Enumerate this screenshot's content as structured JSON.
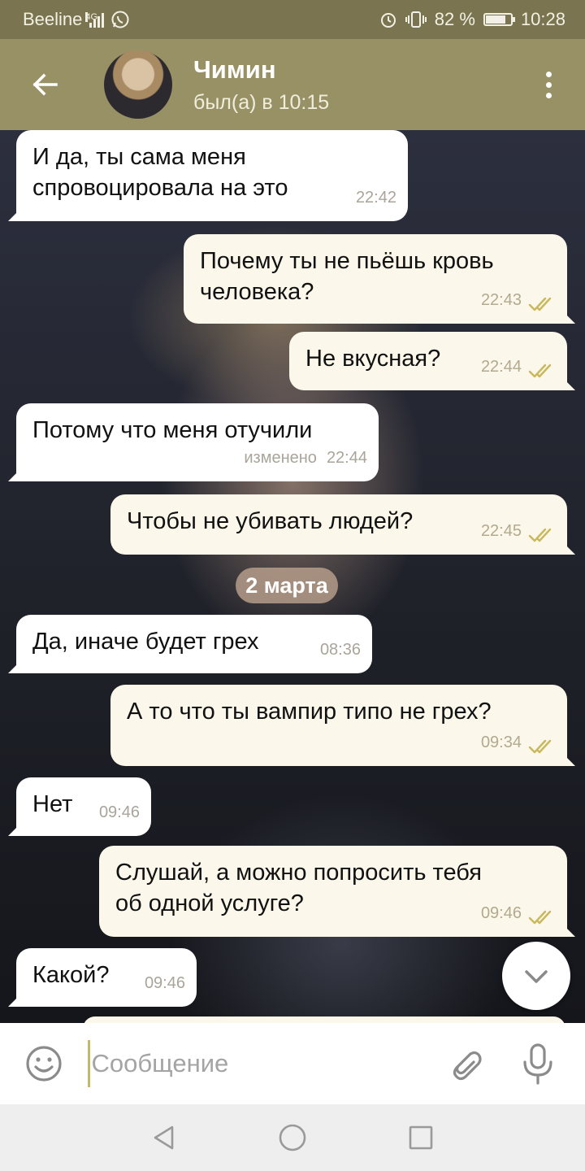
{
  "status_bar": {
    "carrier": "Beeline",
    "network": "4G",
    "battery_text": "82 %",
    "battery_level": 0.82,
    "time": "10:28"
  },
  "header": {
    "name": "Чимин",
    "last_seen": "был(а) в 10:15"
  },
  "messages": [
    {
      "direction": "in",
      "text": "И да, ты сама меня\nспровоцировала на это",
      "time": "22:42"
    },
    {
      "direction": "out",
      "text": "Почему ты не пьёшь кровь\nчеловека?",
      "time": "22:43"
    },
    {
      "direction": "out",
      "text": "Не вкусная?",
      "time": "22:44"
    },
    {
      "direction": "in",
      "text": "Потому что меня отучили",
      "edited": "изменено",
      "time": "22:44"
    },
    {
      "direction": "out",
      "text": "Чтобы не убивать людей?",
      "time": "22:45"
    },
    {
      "direction": "in",
      "text": "Да, иначе будет грех",
      "time": "08:36"
    },
    {
      "direction": "out",
      "text": "А то что ты вампир типо не грех?",
      "time": "09:34"
    },
    {
      "direction": "in",
      "text": "Нет",
      "time": "09:46"
    },
    {
      "direction": "out",
      "text": "Слушай, а можно попросить тебя\nоб одной услуге?",
      "time": "09:46"
    },
    {
      "direction": "in",
      "text": "Какой?",
      "time": "09:46"
    }
  ],
  "date_separator": "2 марта",
  "input": {
    "placeholder": "Сообщение"
  },
  "colors": {
    "status_bar": "#7a7550",
    "header": "#999166",
    "outgoing_bubble": "#fbf7ea",
    "incoming_bubble": "#ffffff",
    "read_checks": "#c9b85c",
    "date_badge": "#baa08c"
  },
  "icons": {
    "back": "arrow-left-icon",
    "menu": "more-vertical-icon",
    "read": "double-check-icon",
    "scroll_down": "chevron-down-icon",
    "emoji": "smiley-icon",
    "attach": "paperclip-icon",
    "mic": "microphone-icon",
    "nav_back": "triangle-back-icon",
    "nav_home": "circle-home-icon",
    "nav_recents": "square-recents-icon"
  }
}
